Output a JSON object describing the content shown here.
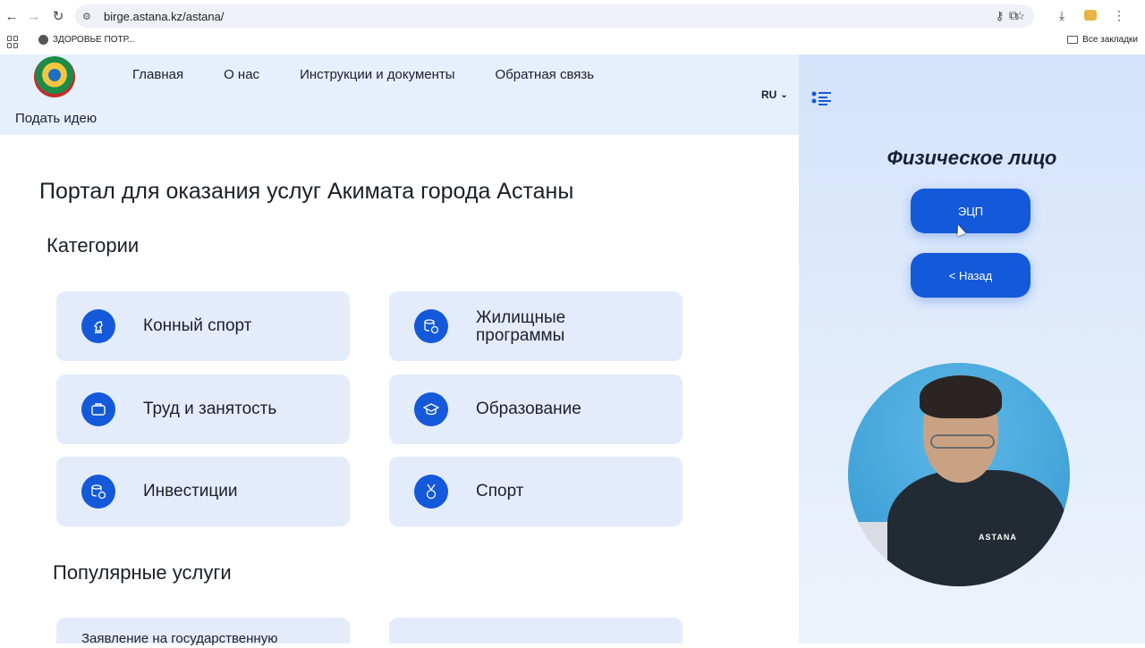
{
  "browser": {
    "url": "birge.astana.kz/astana/",
    "bookmark_label": "ЗДОРОВЬЕ ПОТР...",
    "all_bookmarks_label": "Все закладки"
  },
  "header": {
    "nav": [
      "Главная",
      "О нас",
      "Инструкции и документы",
      "Обратная связь"
    ],
    "language": "RU",
    "idea_link": "Подать идею"
  },
  "main": {
    "title": "Портал для оказания услуг Акимата города Астаны",
    "categories_title": "Категории",
    "categories": [
      {
        "label": "Конный спорт",
        "icon": "chess-knight-icon"
      },
      {
        "label": "Жилищные программы",
        "icon": "coins-icon"
      },
      {
        "label": "Труд и занятость",
        "icon": "briefcase-icon"
      },
      {
        "label": "Образование",
        "icon": "graduation-cap-icon"
      },
      {
        "label": "Инвестиции",
        "icon": "coins-icon"
      },
      {
        "label": "Спорт",
        "icon": "medal-icon"
      }
    ],
    "popular_title": "Популярные услуги",
    "popular": [
      "Заявление на государственную",
      ""
    ]
  },
  "panel": {
    "title": "Физическое лицо",
    "ecp_button": "ЭЦП",
    "back_button": "< Назад"
  },
  "webcam": {
    "shirt_logo": "ASTANA"
  },
  "colors": {
    "accent": "#1459d9",
    "card_bg": "#e4ecfb",
    "header_bg": "#e6effc"
  }
}
